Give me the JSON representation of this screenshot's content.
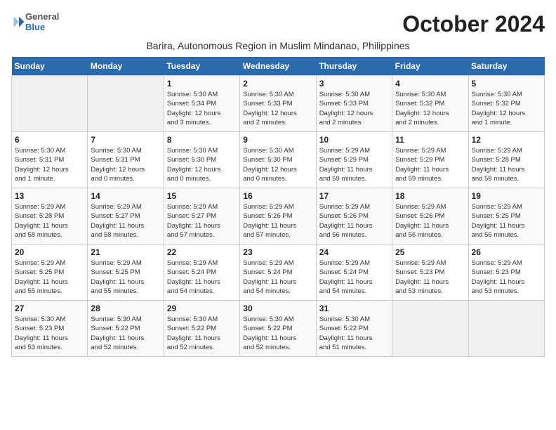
{
  "logo": {
    "general": "General",
    "blue": "Blue"
  },
  "title": "October 2024",
  "subtitle": "Barira, Autonomous Region in Muslim Mindanao, Philippines",
  "headers": [
    "Sunday",
    "Monday",
    "Tuesday",
    "Wednesday",
    "Thursday",
    "Friday",
    "Saturday"
  ],
  "weeks": [
    [
      {
        "day": "",
        "info": ""
      },
      {
        "day": "",
        "info": ""
      },
      {
        "day": "1",
        "info": "Sunrise: 5:30 AM\nSunset: 5:34 PM\nDaylight: 12 hours\nand 3 minutes."
      },
      {
        "day": "2",
        "info": "Sunrise: 5:30 AM\nSunset: 5:33 PM\nDaylight: 12 hours\nand 2 minutes."
      },
      {
        "day": "3",
        "info": "Sunrise: 5:30 AM\nSunset: 5:33 PM\nDaylight: 12 hours\nand 2 minutes."
      },
      {
        "day": "4",
        "info": "Sunrise: 5:30 AM\nSunset: 5:32 PM\nDaylight: 12 hours\nand 2 minutes."
      },
      {
        "day": "5",
        "info": "Sunrise: 5:30 AM\nSunset: 5:32 PM\nDaylight: 12 hours\nand 1 minute."
      }
    ],
    [
      {
        "day": "6",
        "info": "Sunrise: 5:30 AM\nSunset: 5:31 PM\nDaylight: 12 hours\nand 1 minute."
      },
      {
        "day": "7",
        "info": "Sunrise: 5:30 AM\nSunset: 5:31 PM\nDaylight: 12 hours\nand 0 minutes."
      },
      {
        "day": "8",
        "info": "Sunrise: 5:30 AM\nSunset: 5:30 PM\nDaylight: 12 hours\nand 0 minutes."
      },
      {
        "day": "9",
        "info": "Sunrise: 5:30 AM\nSunset: 5:30 PM\nDaylight: 12 hours\nand 0 minutes."
      },
      {
        "day": "10",
        "info": "Sunrise: 5:29 AM\nSunset: 5:29 PM\nDaylight: 11 hours\nand 59 minutes."
      },
      {
        "day": "11",
        "info": "Sunrise: 5:29 AM\nSunset: 5:29 PM\nDaylight: 11 hours\nand 59 minutes."
      },
      {
        "day": "12",
        "info": "Sunrise: 5:29 AM\nSunset: 5:28 PM\nDaylight: 11 hours\nand 58 minutes."
      }
    ],
    [
      {
        "day": "13",
        "info": "Sunrise: 5:29 AM\nSunset: 5:28 PM\nDaylight: 11 hours\nand 58 minutes."
      },
      {
        "day": "14",
        "info": "Sunrise: 5:29 AM\nSunset: 5:27 PM\nDaylight: 11 hours\nand 58 minutes."
      },
      {
        "day": "15",
        "info": "Sunrise: 5:29 AM\nSunset: 5:27 PM\nDaylight: 11 hours\nand 57 minutes."
      },
      {
        "day": "16",
        "info": "Sunrise: 5:29 AM\nSunset: 5:26 PM\nDaylight: 11 hours\nand 57 minutes."
      },
      {
        "day": "17",
        "info": "Sunrise: 5:29 AM\nSunset: 5:26 PM\nDaylight: 11 hours\nand 56 minutes."
      },
      {
        "day": "18",
        "info": "Sunrise: 5:29 AM\nSunset: 5:26 PM\nDaylight: 11 hours\nand 56 minutes."
      },
      {
        "day": "19",
        "info": "Sunrise: 5:29 AM\nSunset: 5:25 PM\nDaylight: 11 hours\nand 56 minutes."
      }
    ],
    [
      {
        "day": "20",
        "info": "Sunrise: 5:29 AM\nSunset: 5:25 PM\nDaylight: 11 hours\nand 55 minutes."
      },
      {
        "day": "21",
        "info": "Sunrise: 5:29 AM\nSunset: 5:25 PM\nDaylight: 11 hours\nand 55 minutes."
      },
      {
        "day": "22",
        "info": "Sunrise: 5:29 AM\nSunset: 5:24 PM\nDaylight: 11 hours\nand 54 minutes."
      },
      {
        "day": "23",
        "info": "Sunrise: 5:29 AM\nSunset: 5:24 PM\nDaylight: 11 hours\nand 54 minutes."
      },
      {
        "day": "24",
        "info": "Sunrise: 5:29 AM\nSunset: 5:24 PM\nDaylight: 11 hours\nand 54 minutes."
      },
      {
        "day": "25",
        "info": "Sunrise: 5:29 AM\nSunset: 5:23 PM\nDaylight: 11 hours\nand 53 minutes."
      },
      {
        "day": "26",
        "info": "Sunrise: 5:29 AM\nSunset: 5:23 PM\nDaylight: 11 hours\nand 53 minutes."
      }
    ],
    [
      {
        "day": "27",
        "info": "Sunrise: 5:30 AM\nSunset: 5:23 PM\nDaylight: 11 hours\nand 53 minutes."
      },
      {
        "day": "28",
        "info": "Sunrise: 5:30 AM\nSunset: 5:22 PM\nDaylight: 11 hours\nand 52 minutes."
      },
      {
        "day": "29",
        "info": "Sunrise: 5:30 AM\nSunset: 5:22 PM\nDaylight: 11 hours\nand 52 minutes."
      },
      {
        "day": "30",
        "info": "Sunrise: 5:30 AM\nSunset: 5:22 PM\nDaylight: 11 hours\nand 52 minutes."
      },
      {
        "day": "31",
        "info": "Sunrise: 5:30 AM\nSunset: 5:22 PM\nDaylight: 11 hours\nand 51 minutes."
      },
      {
        "day": "",
        "info": ""
      },
      {
        "day": "",
        "info": ""
      }
    ]
  ]
}
